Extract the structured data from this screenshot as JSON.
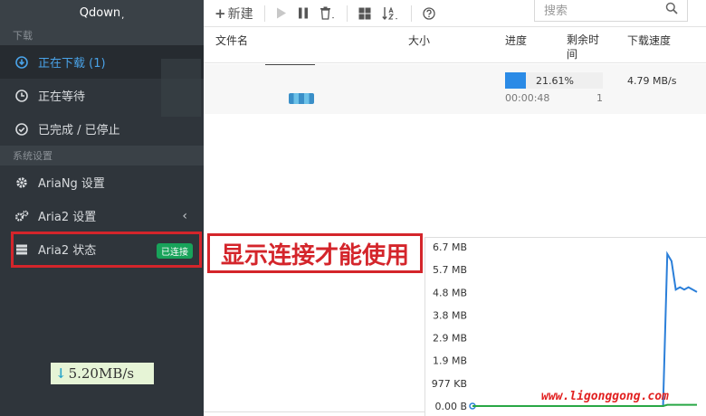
{
  "app": {
    "title": "Qdown",
    "title_mark": ","
  },
  "sidebar": {
    "section_download": "下载",
    "items_download": [
      {
        "label": "正在下载 (1)",
        "icon": "download-circle-icon"
      },
      {
        "label": "正在等待",
        "icon": "clock-icon"
      },
      {
        "label": "已完成 / 已停止",
        "icon": "check-circle-icon"
      }
    ],
    "section_settings": "系统设置",
    "items_settings": [
      {
        "label": "AriaNg 设置",
        "icon": "gear-icon"
      },
      {
        "label": "Aria2 设置",
        "icon": "gears-icon",
        "chevron": "‹"
      },
      {
        "label": "Aria2 状态",
        "icon": "server-icon",
        "badge": "已连接"
      }
    ],
    "speed": {
      "arrow": "↓",
      "value": "5.20MB/s"
    }
  },
  "toolbar": {
    "new_label": "新建",
    "new_icon": "plus-icon",
    "search_placeholder": "搜索"
  },
  "table": {
    "headers": {
      "name": "文件名",
      "size": "大小",
      "progress": "进度",
      "remaining": "剩余时间",
      "speed": "下载速度"
    },
    "rows": [
      {
        "name": "",
        "size": "",
        "progress_fraction": 0.2161,
        "progress_text": "21.61%",
        "elapsed": "00:00:48",
        "connections": "1",
        "speed": "4.79 MB/s"
      }
    ]
  },
  "annotation": {
    "text": "显示连接才能使用"
  },
  "chart_data": {
    "type": "line",
    "y_ticks": [
      "6.7 MB",
      "5.7 MB",
      "4.8 MB",
      "3.8 MB",
      "2.9 MB",
      "1.9 MB",
      "977 KB",
      "0.00 B"
    ],
    "ylim": [
      0,
      6.7
    ],
    "series": [
      {
        "color": "#2b7fd9",
        "values": [
          0,
          0,
          0,
          0,
          0,
          0,
          0,
          0,
          0,
          0,
          0,
          0,
          0,
          0,
          0,
          0,
          0,
          0,
          0,
          0,
          0,
          0,
          0,
          0,
          0,
          0,
          0,
          0,
          0,
          0,
          0,
          0,
          0,
          0,
          0,
          0,
          0,
          0,
          0,
          0,
          0,
          0,
          0,
          0,
          0,
          0,
          6.4,
          6.1,
          4.9,
          5.0,
          4.9,
          5.0,
          4.9,
          4.8
        ]
      },
      {
        "color": "#28a745",
        "values": [
          0,
          0,
          0,
          0,
          0,
          0,
          0,
          0,
          0,
          0,
          0,
          0,
          0,
          0,
          0,
          0,
          0,
          0,
          0,
          0,
          0,
          0,
          0,
          0,
          0,
          0,
          0,
          0,
          0,
          0,
          0,
          0,
          0,
          0,
          0,
          0,
          0,
          0,
          0,
          0,
          0,
          0,
          0,
          0,
          0,
          0,
          0.05,
          0.05,
          0.05,
          0.05,
          0.05,
          0.05,
          0.05,
          0.05
        ]
      }
    ]
  },
  "watermark": "www.ligonggong.com"
}
